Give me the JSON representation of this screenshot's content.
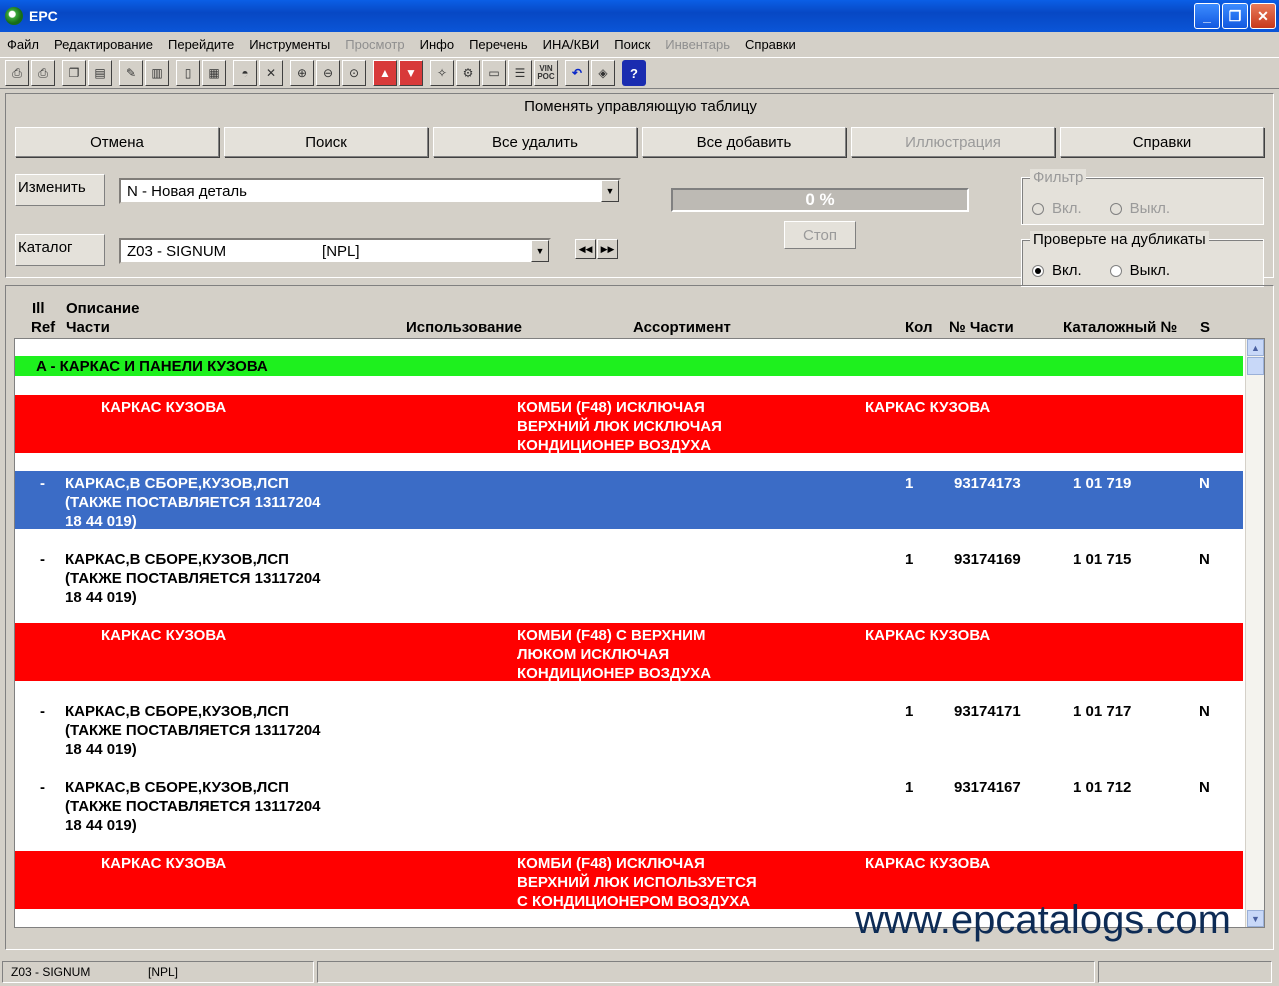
{
  "window": {
    "title": "EPC"
  },
  "menu": [
    "Файл",
    "Редактирование",
    "Перейдите",
    "Инструменты",
    "Просмотр",
    "Инфо",
    "Перечень",
    "ИНА/КВИ",
    "Поиск",
    "Инвентарь",
    "Справки"
  ],
  "menu_disabled": [
    "Просмотр",
    "Инвентарь"
  ],
  "toolbar": {
    "vin_label": "VIN\nPOC",
    "help_label": "?"
  },
  "panel": {
    "title": "Поменять управляющую таблицу",
    "buttons": {
      "cancel": "Отмена",
      "search": "Поиск",
      "delete_all": "Все удалить",
      "add_all": "Все добавить",
      "illustration": "Иллюстрация",
      "help": "Справки"
    },
    "change_label": "Изменить",
    "change_value": "N - Новая деталь",
    "catalog_label": "Каталог",
    "catalog_value": "Z03 - SIGNUM                       [NPL]",
    "progress": "0 %",
    "stop": "Стоп",
    "filter": {
      "legend": "Фильтр",
      "on": "Вкл.",
      "off": "Выкл."
    },
    "duplicates": {
      "legend": "Проверьте на дубликаты",
      "on": "Вкл.",
      "off": "Выкл.",
      "selected": "on"
    }
  },
  "columns": {
    "ill": "Ill",
    "ref": "Ref",
    "desc_top": "Описание",
    "desc_bottom": "Части",
    "usage": "Использование",
    "assortment": "Ассортимент",
    "qty": "Кол",
    "part_no": "№ Части",
    "catalog_no": "Каталожный №",
    "s": "S"
  },
  "rows": [
    {
      "type": "green",
      "description": "A - КАРКАС И ПАНЕЛИ КУЗОВА"
    },
    {
      "type": "red",
      "description": "КАРКАС КУЗОВА",
      "usage": "КОМБИ (F48) ИСКЛЮЧАЯ\nВЕРХНИЙ ЛЮК ИСКЛЮЧАЯ\nКОНДИЦИОНЕР ВОЗДУХА",
      "assortment": "КАРКАС КУЗОВА"
    },
    {
      "type": "selected",
      "ref": "-",
      "description": "КАРКАС,В СБОРЕ,КУЗОВ,ЛСП\n(ТАКЖЕ ПОСТАВЛЯЕТСЯ 13117204\n18 44 019)",
      "qty": "1",
      "part_no": "93174173",
      "catalog_no": "1 01 719",
      "s": "N"
    },
    {
      "type": "normal",
      "ref": "-",
      "description": "КАРКАС,В СБОРЕ,КУЗОВ,ЛСП\n(ТАКЖЕ ПОСТАВЛЯЕТСЯ 13117204\n18 44 019)",
      "qty": "1",
      "part_no": "93174169",
      "catalog_no": "1 01 715",
      "s": "N"
    },
    {
      "type": "red",
      "description": "КАРКАС КУЗОВА",
      "usage": "КОМБИ (F48) С ВЕРХНИМ\nЛЮКОМ ИСКЛЮЧАЯ\nКОНДИЦИОНЕР ВОЗДУХА",
      "assortment": "КАРКАС КУЗОВА"
    },
    {
      "type": "normal",
      "ref": "-",
      "description": "КАРКАС,В СБОРЕ,КУЗОВ,ЛСП\n(ТАКЖЕ ПОСТАВЛЯЕТСЯ 13117204\n18 44 019)",
      "qty": "1",
      "part_no": "93174171",
      "catalog_no": "1 01 717",
      "s": "N"
    },
    {
      "type": "normal",
      "ref": "-",
      "description": "КАРКАС,В СБОРЕ,КУЗОВ,ЛСП\n(ТАКЖЕ ПОСТАВЛЯЕТСЯ 13117204\n18 44 019)",
      "qty": "1",
      "part_no": "93174167",
      "catalog_no": "1 01 712",
      "s": "N"
    },
    {
      "type": "red",
      "description": "КАРКАС КУЗОВА",
      "usage": "КОМБИ (F48) ИСКЛЮЧАЯ\nВЕРХНИЙ ЛЮК ИСПОЛЬЗУЕТСЯ\nС КОНДИЦИОНЕРОМ ВОЗДУХА",
      "assortment": "КАРКАС КУЗОВА"
    }
  ],
  "watermark": "www.epcatalogs.com",
  "status": {
    "catalog": "Z03 - SIGNUM",
    "npl": "[NPL]"
  },
  "colors": {
    "green_row": "#1ef01e",
    "red_row": "#ff0000",
    "selected_row": "#3b6cc6"
  }
}
